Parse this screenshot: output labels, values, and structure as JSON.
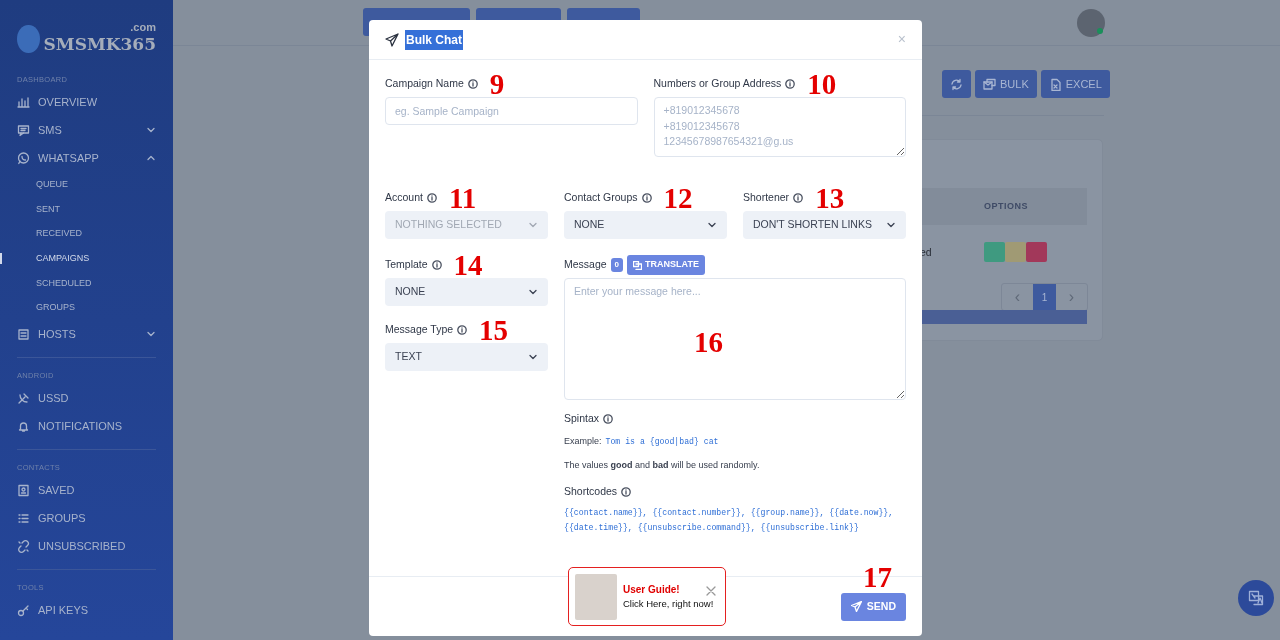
{
  "sidebar": {
    "logo": {
      "name": "SMSMK365",
      "suffix": ".com"
    },
    "sections": [
      {
        "title": "DASHBOARD",
        "items": [
          {
            "kind": "link",
            "label": "OVERVIEW"
          },
          {
            "kind": "group",
            "label": "SMS",
            "expanded": false
          },
          {
            "kind": "group",
            "label": "WHATSAPP",
            "expanded": true,
            "children": [
              {
                "label": "QUEUE",
                "selected": false
              },
              {
                "label": "SENT",
                "selected": false
              },
              {
                "label": "RECEIVED",
                "selected": false
              },
              {
                "label": "CAMPAIGNS",
                "selected": true
              },
              {
                "label": "SCHEDULED",
                "selected": false
              },
              {
                "label": "GROUPS",
                "selected": false
              }
            ]
          },
          {
            "kind": "group",
            "label": "HOSTS",
            "expanded": false
          }
        ]
      },
      {
        "title": "ANDROID",
        "items": [
          {
            "kind": "link",
            "label": "USSD"
          },
          {
            "kind": "link",
            "label": "NOTIFICATIONS"
          }
        ]
      },
      {
        "title": "CONTACTS",
        "items": [
          {
            "kind": "link",
            "label": "SAVED"
          },
          {
            "kind": "link",
            "label": "GROUPS"
          },
          {
            "kind": "link",
            "label": "UNSUBSCRIBED"
          }
        ]
      },
      {
        "title": "TOOLS",
        "items": [
          {
            "kind": "link",
            "label": "API KEYS"
          }
        ]
      }
    ]
  },
  "toolbar": {
    "buttons": [
      {
        "kind": "refresh"
      },
      {
        "kind": "bulk",
        "label": "BULK"
      },
      {
        "kind": "excel",
        "label": "EXCEL"
      }
    ]
  },
  "table": {
    "columns": [
      {
        "label": "OPTIONS"
      }
    ],
    "rows": [
      {
        "cell": "ed"
      }
    ]
  },
  "pagination": {
    "previous": "‹",
    "pages": [
      {
        "label": "1",
        "selected": true
      }
    ],
    "next": "›"
  },
  "modal": {
    "title": "Bulk Chat",
    "close": "×",
    "campaign_name": {
      "label": "Campaign Name",
      "placeholder": "eg. Sample Campaign",
      "annotation": "9"
    },
    "numbers": {
      "label": "Numbers or Group Address",
      "placeholder": "+819012345678\n+819012345678\n12345678987654321@g.us",
      "annotation": "10"
    },
    "selects": [
      {
        "label": "Account",
        "value": "NOTHING SELECTED",
        "disabled": true,
        "annotation": "11"
      },
      {
        "label": "Contact Groups",
        "value": "NONE",
        "disabled": false,
        "annotation": "12"
      },
      {
        "label": "Shortener",
        "value": "DON'T SHORTEN LINKS",
        "disabled": false,
        "annotation": "13"
      },
      {
        "label": "Template",
        "value": "NONE",
        "disabled": false,
        "annotation": "14"
      },
      {
        "label": "Message Type",
        "value": "TEXT",
        "disabled": false,
        "annotation": "15"
      }
    ],
    "message": {
      "label": "Message",
      "count": "0",
      "translate_button": "TRANSLATE",
      "placeholder": "Enter your message here...",
      "annotation": "16"
    },
    "spintax": {
      "label": "Spintax",
      "example_label": "Example:",
      "example": "Tom is a {good|bad} cat",
      "note": "The values **good** and **bad** will be used randomly."
    },
    "shortcodes": {
      "label": "Shortcodes",
      "codes": "{{contact.name}}, {{contact.number}}, {{group.name}}, {{date.now}}, {{date.time}}, {{unsubscribe.command}}, {{unsubscribe.link}}"
    },
    "send_button": {
      "label": "SEND",
      "annotation": "17"
    }
  },
  "user_guide": {
    "title": "User Guide!",
    "text": "Click Here, right now!"
  }
}
